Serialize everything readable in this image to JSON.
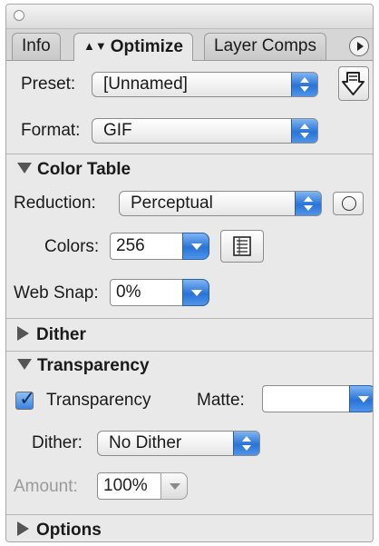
{
  "tabs": [
    {
      "label": "Info"
    },
    {
      "label": "Optimize"
    },
    {
      "label": "Layer Comps"
    }
  ],
  "preset": {
    "label": "Preset:",
    "value": "[Unnamed]"
  },
  "format": {
    "label": "Format:",
    "value": "GIF"
  },
  "color_table": {
    "title": "Color Table",
    "reduction": {
      "label": "Reduction:",
      "value": "Perceptual"
    },
    "colors": {
      "label": "Colors:",
      "value": "256"
    },
    "web_snap": {
      "label": "Web Snap:",
      "value": "0%"
    }
  },
  "dither_section": {
    "title": "Dither"
  },
  "transparency": {
    "title": "Transparency",
    "checkbox_label": "Transparency",
    "checked": true,
    "matte_label": "Matte:",
    "matte_value": "",
    "dither": {
      "label": "Dither:",
      "value": "No Dither"
    },
    "amount": {
      "label": "Amount:",
      "value": "100%"
    }
  },
  "options_section": {
    "title": "Options"
  },
  "icons": {
    "optimize_to_size": "optimize-to-size-icon",
    "selective_color": "circle-icon",
    "color_table_page": "page-icon",
    "panel_menu": "panel-menu-icon",
    "close": "close-dot-icon"
  }
}
